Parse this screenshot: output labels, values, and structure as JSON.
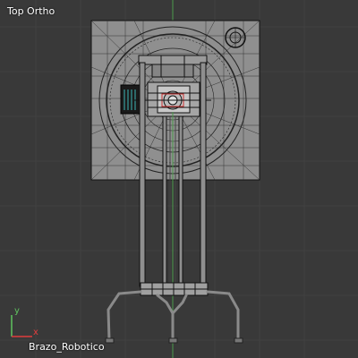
{
  "viewport": {
    "view_name": "Top Ortho",
    "active_object": "Brazo_Robotico",
    "background_color": "#393939",
    "wire_color": "#000000",
    "object_fill": "#8f8f8f"
  },
  "axes": {
    "x_label": "x",
    "y_label": "y",
    "x_color": "#e03d3d",
    "y_color": "#5fc25f",
    "x_line_color": "#8a3a3a",
    "y_line_color": "#4a9a4a"
  },
  "icons": {
    "view_axis_gizmo": "axis-gizmo-icon"
  }
}
